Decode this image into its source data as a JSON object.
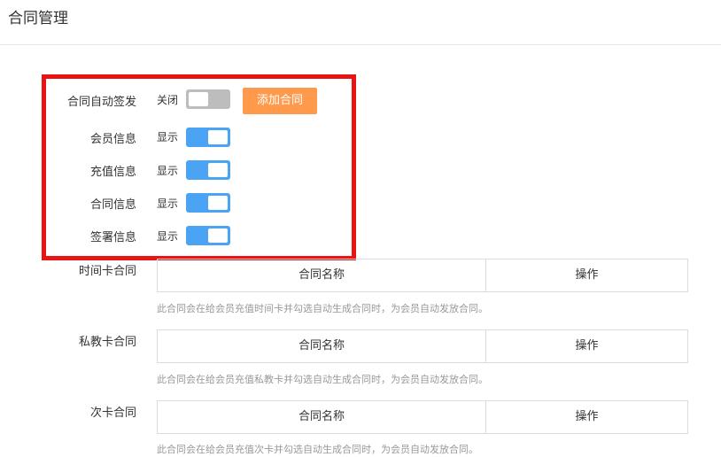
{
  "header": {
    "title": "合同管理"
  },
  "settings": [
    {
      "label": "合同自动签发",
      "state": "关闭",
      "on": false
    },
    {
      "label": "会员信息",
      "state": "显示",
      "on": true
    },
    {
      "label": "充值信息",
      "state": "显示",
      "on": true
    },
    {
      "label": "合同信息",
      "state": "显示",
      "on": true
    },
    {
      "label": "签署信息",
      "state": "显示",
      "on": true
    }
  ],
  "add_button_label": "添加合同",
  "sections": [
    {
      "label": "时间卡合同",
      "col_name": "合同名称",
      "col_op": "操作",
      "hint": "此合同会在给会员充值时间卡并勾选自动生成合同时，为会员自动发放合同。"
    },
    {
      "label": "私教卡合同",
      "col_name": "合同名称",
      "col_op": "操作",
      "hint": "此合同会在给会员充值私教卡并勾选自动生成合同时，为会员自动发放合同。"
    },
    {
      "label": "次卡合同",
      "col_name": "合同名称",
      "col_op": "操作",
      "hint": "此合同会在给会员充值次卡并勾选自动生成合同时，为会员自动发放合同。"
    }
  ],
  "colors": {
    "highlight": "#e81313",
    "toggle_on": "#4aa3f3",
    "toggle_off": "#bdbdbd",
    "button": "#ff9a4d"
  }
}
